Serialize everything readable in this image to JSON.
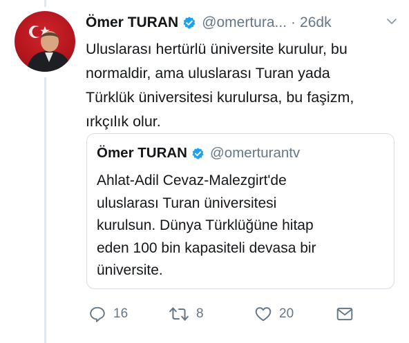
{
  "tweet": {
    "author_name": "Ömer TURAN",
    "handle": "@omertura...",
    "separator": "·",
    "time": "26dk",
    "text_lines": [
      "Uluslarası hertürlü üniversite kurulur, bu",
      "normaldir, ama uluslarası Turan yada",
      "Türklük üniversitesi kurulursa, bu faşizm,",
      "ırkçılık olur."
    ]
  },
  "quoted_tweet": {
    "author_name": "Ömer TURAN",
    "handle": "@omerturantv",
    "text_lines": [
      "Ahlat-Adil Cevaz-Malezgirt'de",
      "uluslarası Turan üniversitesi",
      "kurulsun. Dünya Türklüğüne hitap",
      "eden 100 bin kapasiteli devasa bir",
      "üniversite."
    ]
  },
  "actions": {
    "reply_count": "16",
    "retweet_count": "8",
    "like_count": "20"
  },
  "colors": {
    "verified": "#1da1f2",
    "muted": "#657786",
    "border": "#d7dde2"
  },
  "icons": [
    "verified-badge-icon",
    "chevron-down-icon",
    "reply-icon",
    "retweet-icon",
    "like-icon",
    "message-icon"
  ]
}
